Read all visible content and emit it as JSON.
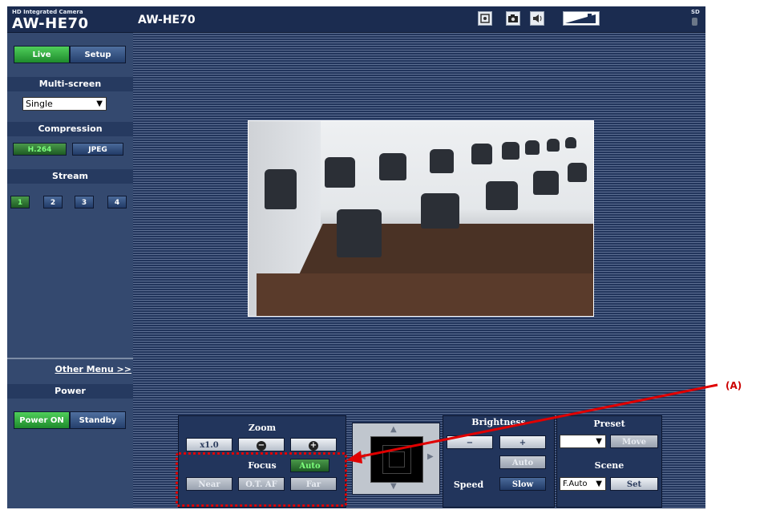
{
  "header": {
    "brand_small": "HD Integrated Camera",
    "brand_model": "AW-HE70",
    "title": "AW-HE70",
    "icons": [
      "full-screen-icon",
      "snapshot-camera-icon",
      "audio-speaker-icon",
      "volume-level-icon"
    ],
    "sd_label": "SD"
  },
  "sidebar": {
    "live_label": "Live",
    "setup_label": "Setup",
    "multiscreen_title": "Multi-screen",
    "multiscreen_value": "Single",
    "compression_title": "Compression",
    "h264_label": "H.264",
    "jpeg_label": "JPEG",
    "stream_title": "Stream",
    "streams": [
      "1",
      "2",
      "3",
      "4"
    ],
    "other_menu": "Other Menu >>",
    "power_title": "Power",
    "power_on_label": "Power ON",
    "standby_label": "Standby"
  },
  "controls": {
    "zoom_title": "Zoom",
    "zoom_reset": "x1.0",
    "zoom_out": "−",
    "zoom_in": "+",
    "focus_title": "Focus",
    "focus_auto": "Auto",
    "focus_near": "Near",
    "focus_otaf": "O.T. AF",
    "focus_far": "Far",
    "brightness_title": "Brightness",
    "brightness_minus": "−",
    "brightness_plus": "+",
    "brightness_auto": "Auto",
    "speed_title": "Speed",
    "speed_value": "Slow",
    "preset_title": "Preset",
    "preset_value": "",
    "preset_move": "Move",
    "scene_title": "Scene",
    "scene_value": "F.Auto",
    "scene_set": "Set"
  },
  "annotation": {
    "callout": "(A)"
  },
  "colors": {
    "accent_green": "#1e8a2c",
    "panel_navy": "#22355c",
    "callout_red": "#e00000"
  }
}
